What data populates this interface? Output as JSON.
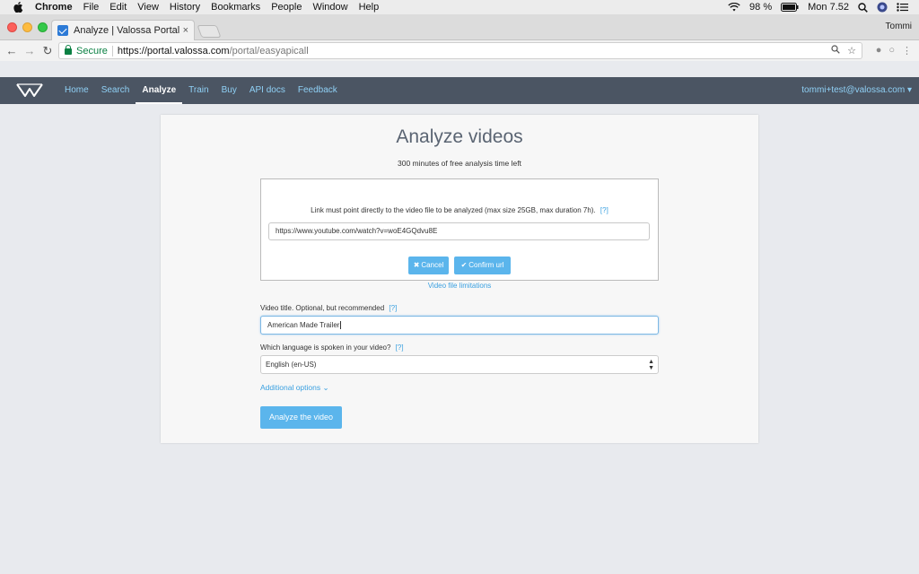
{
  "menubar": {
    "app": "Chrome",
    "items": [
      "File",
      "Edit",
      "View",
      "History",
      "Bookmarks",
      "People",
      "Window",
      "Help"
    ],
    "battery": "98 %",
    "clock": "Mon 7.52"
  },
  "browser": {
    "tab_title": "Analyze | Valossa Portal",
    "tab_close": "×",
    "profile": "Tommi",
    "secure_label": "Secure",
    "url_host": "https://portal.valossa.com",
    "url_path": "/portal/easyapicall"
  },
  "sitenav": {
    "links": [
      "Home",
      "Search",
      "Analyze",
      "Train",
      "Buy",
      "API docs",
      "Feedback"
    ],
    "active": "Analyze",
    "user": "tommi+test@valossa.com ▾"
  },
  "page": {
    "title": "Analyze videos",
    "subtitle": "300 minutes of free analysis time left",
    "url_hint": "Link must point directly to the video file to be analyzed (max size 25GB, max duration 7h).",
    "help_mark": "[?]",
    "url_value": "https://www.youtube.com/watch?v=woE4GQdvu8E",
    "cancel_label": "Cancel",
    "confirm_label": "Confirm url",
    "limits_link": "Video file limitations",
    "title_label": "Video title. Optional, but recommended",
    "title_value": "American Made Trailer",
    "lang_label": "Which language is spoken in your video?",
    "lang_value": "English (en-US)",
    "additional_options": "Additional options",
    "analyze_button": "Analyze the video"
  },
  "colors": {
    "nav_bg": "#4b5563",
    "link": "#3aa0e0",
    "button": "#5bb5ec"
  }
}
